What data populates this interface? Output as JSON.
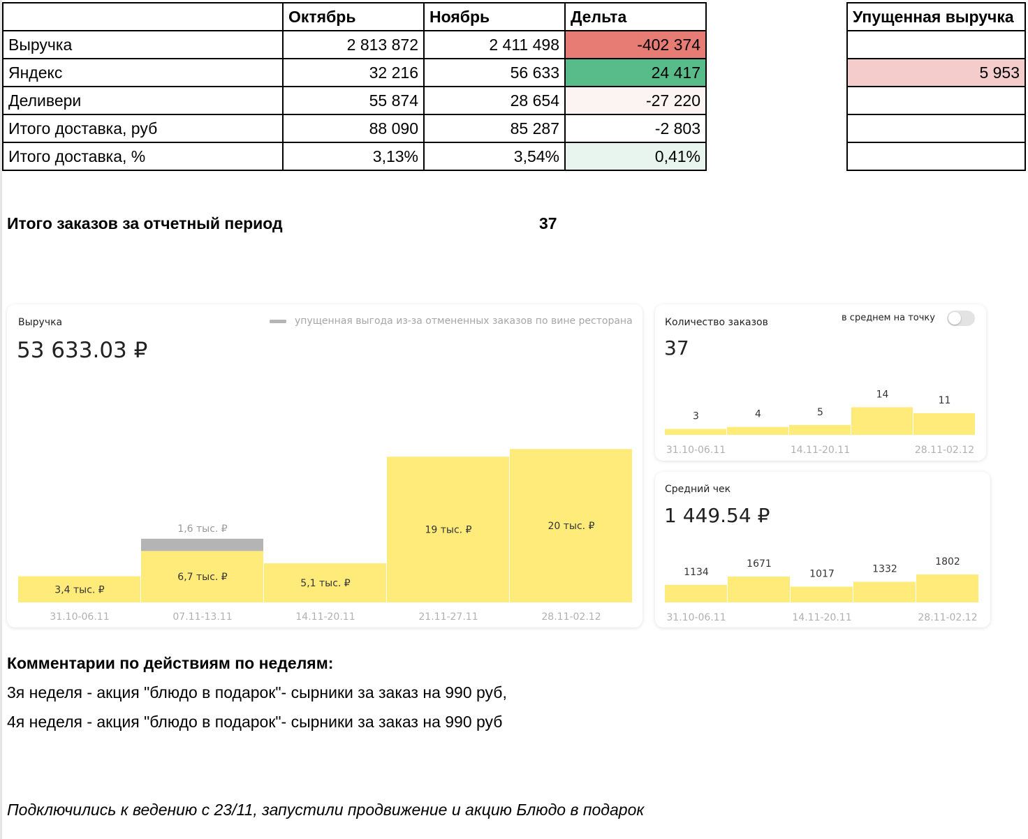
{
  "table": {
    "headers": [
      "",
      "Октябрь",
      "Ноябрь",
      "Дельта"
    ],
    "rows": [
      {
        "label": "Выручка",
        "oct": "2 813 872",
        "nov": "2 411 498",
        "delta": "-402 374",
        "delta_color": "#e67c73"
      },
      {
        "label": "Яндекс",
        "oct": "32 216",
        "nov": "56 633",
        "delta": "24 417",
        "delta_color": "#57bb8a"
      },
      {
        "label": "Деливери",
        "oct": "55 874",
        "nov": "28 654",
        "delta": "-27 220",
        "delta_color": "#fcf4f3"
      },
      {
        "label": "Итого доставка, руб",
        "oct": "88 090",
        "nov": "85 287",
        "delta": "-2 803",
        "delta_color": "#ffffff"
      },
      {
        "label": "Итого доставка, %",
        "oct": "3,13%",
        "nov": "3,54%",
        "delta": "0,41%",
        "delta_color": "#e8f5ee"
      }
    ]
  },
  "lost_revenue": {
    "header": "Упущенная выручка",
    "values": [
      "",
      "5 953",
      "",
      "",
      ""
    ],
    "highlight_color": "#f4cccc"
  },
  "total_orders": {
    "label": "Итого заказов за отчетный период",
    "value": "37"
  },
  "revenue_widget": {
    "label": "Выручка",
    "legend": "упущенная выгода из-за отмененных заказов по вине ресторана",
    "total": "53 633.03 ₽"
  },
  "orders_widget": {
    "label": "Количество заказов",
    "toggle_label": "в среднем на точку",
    "total": "37"
  },
  "avg_check_widget": {
    "label": "Средний чек",
    "total": "1 449.54 ₽"
  },
  "chart_data": [
    {
      "type": "bar",
      "title": "Выручка",
      "categories": [
        "31.10-06.11",
        "07.11-13.11",
        "14.11-20.11",
        "21.11-27.11",
        "28.11-02.12"
      ],
      "series": [
        {
          "name": "",
          "values": [
            3.4,
            6.7,
            5.1,
            19,
            20
          ],
          "labels": [
            "3,4 тыс. ₽",
            "6,7 тыс. ₽",
            "5,1 тыс. ₽",
            "19 тыс. ₽",
            "20 тыс. ₽"
          ],
          "color": "#ffeb7a"
        },
        {
          "name": "упущенная выгода из-за отмененных заказов по вине ресторана",
          "values": [
            0,
            1.6,
            0,
            0,
            0
          ],
          "labels": [
            "",
            "1,6 тыс. ₽",
            "",
            "",
            ""
          ],
          "color": "#b4b4b4"
        }
      ],
      "stacked": true,
      "ylim": [
        0,
        22.3
      ],
      "grid": false
    },
    {
      "type": "bar",
      "title": "Количество заказов",
      "categories": [
        "31.10-06.11",
        "07.11-13.11",
        "14.11-20.11",
        "21.11-27.11",
        "28.11-02.12"
      ],
      "tick_labels": [
        "31.10-06.11",
        "",
        "14.11-20.11",
        "",
        "28.11-02.12"
      ],
      "values": [
        3,
        4,
        5,
        14,
        11
      ],
      "ylim": [
        0,
        14.5
      ],
      "grid": false
    },
    {
      "type": "bar",
      "title": "Средний чек",
      "categories": [
        "31.10-06.11",
        "07.11-13.11",
        "14.11-20.11",
        "21.11-27.11",
        "28.11-02.12"
      ],
      "tick_labels": [
        "31.10-06.11",
        "",
        "14.11-20.11",
        "",
        "28.11-02.12"
      ],
      "values": [
        1134,
        1671,
        1017,
        1332,
        1802
      ],
      "ylim": [
        0,
        1850
      ],
      "grid": false
    }
  ],
  "comments": {
    "title": "Комментарии по действиям по неделям:",
    "lines": [
      "3я неделя - акция \"блюдо в подарок\"- сырники за заказ на 990 руб,",
      "4я неделя - акция \"блюдо в подарок\"- сырники за заказ на 990 руб"
    ],
    "note": "Подключились к ведению с 23/11, запустили продвижение и акцию Блюдо в подарок"
  }
}
